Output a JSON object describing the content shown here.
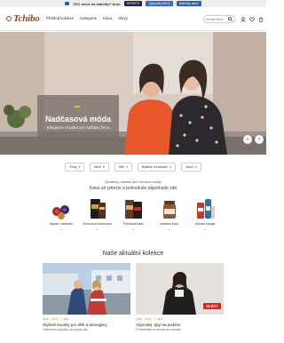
{
  "promo": {
    "text": "20% sleva na kabelky? Ano!",
    "chips": [
      "SPORTS",
      "Výprodej SALE",
      "Nabídky akce"
    ]
  },
  "header": {
    "logo": "Tchibo",
    "nav": [
      "Přehled kolekce",
      "Kategorie",
      "Káva",
      "Slevy"
    ],
    "search_placeholder": "Hledat zboží",
    "icons": [
      "search-icon",
      "user-icon",
      "heart-icon",
      "cart-icon"
    ]
  },
  "hero": {
    "title": "Nadčasová móda",
    "subtitle": "Elegance vhodná pro každou ženu",
    "colors": {
      "sweater": "#e8562b",
      "background": "#d8cbc0",
      "box": "#786e68",
      "tag": "#e8c23a"
    }
  },
  "filters": [
    "Ženy",
    "Muži",
    "Děti",
    "Bydlení a kuchyně",
    "Sport"
  ],
  "coffee": {
    "tagline": "Skutečný zážitek pro chuťové buňky",
    "subtitle": "Káva už vyberte a jednoduše objednejte zde",
    "products": [
      {
        "label": "Kapsle Cafissimo",
        "icon": "capsules-icon"
      },
      {
        "label": "Zrnková a mletá káva",
        "icon": "coffee-bag-icon"
      },
      {
        "label": "Prémiová káva",
        "icon": "premium-coffee-icon"
      },
      {
        "label": "Instantní káva",
        "icon": "instant-jar-icon"
      },
      {
        "label": "Kávové nápoje",
        "icon": "coffee-drink-icon"
      }
    ]
  },
  "collections": {
    "title": "Naše aktuální kolekce",
    "cards": [
      {
        "tag": "Muži · Ženy · V akci",
        "name": "Stylové kousky pro děti a teenagery",
        "desc": "Oblečení a doplňky pro každý den"
      },
      {
        "tag": "Muži · Ženy · V akci",
        "name": "Výprodej: tipy na podzim",
        "desc": "Prohlédněte si zlevněnou nabídku",
        "badge": "SLEVY"
      }
    ]
  },
  "brand_color": "#8b4a22"
}
